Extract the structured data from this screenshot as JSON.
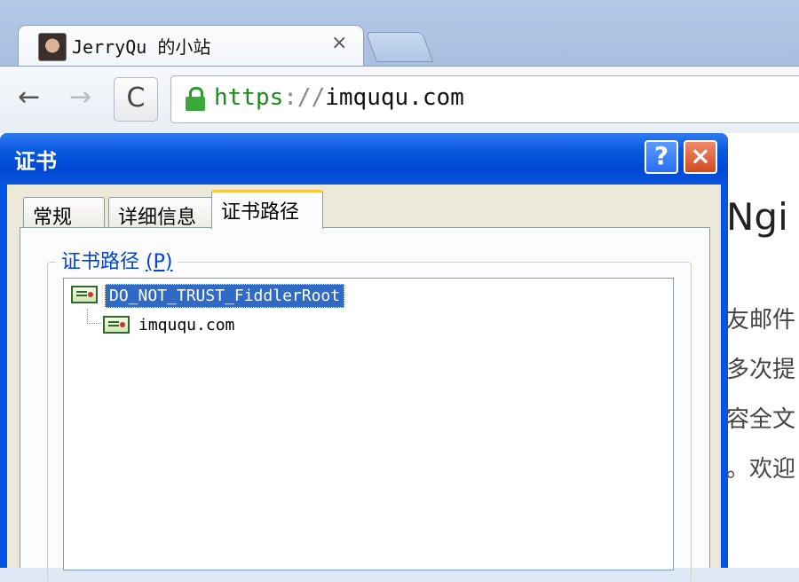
{
  "browser": {
    "tab": {
      "title": "JerryQu 的小站",
      "close": "×"
    },
    "toolbar": {
      "back": "←",
      "forward": "→",
      "reload": "C"
    },
    "omnibox": {
      "scheme": "https",
      "separator": "://",
      "host": "imququ.com"
    }
  },
  "page": {
    "heading": "Ngi",
    "lines": [
      "友邮件",
      "多次提",
      "容全文",
      "。欢迎"
    ]
  },
  "dialog": {
    "title": "证书",
    "help_label": "?",
    "close_label": "×",
    "tabs": [
      {
        "label": "常规"
      },
      {
        "label": "详细信息"
      },
      {
        "label": "证书路径",
        "selected": true
      }
    ],
    "group": {
      "label": "证书路径",
      "mnemonic": "(P)"
    },
    "tree": [
      {
        "label": "DO_NOT_TRUST_FiddlerRoot",
        "selected": true
      },
      {
        "label": "imququ.com"
      }
    ]
  },
  "colors": {
    "titlebar": "#0054e3",
    "selection": "#316ac5",
    "secure_green": "#1b8a1b",
    "group_label": "#0046d5",
    "active_tab_accent": "#ffc83c"
  },
  "icons": {
    "favicon": "avatar-icon",
    "lock": "lock-icon",
    "certificate": "certificate-icon"
  }
}
